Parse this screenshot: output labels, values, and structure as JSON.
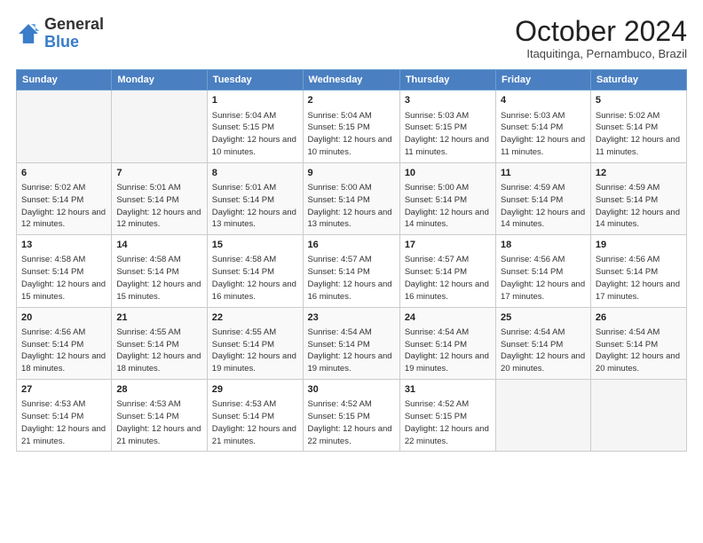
{
  "header": {
    "logo_general": "General",
    "logo_blue": "Blue",
    "month_title": "October 2024",
    "location": "Itaquitinga, Pernambuco, Brazil"
  },
  "days_of_week": [
    "Sunday",
    "Monday",
    "Tuesday",
    "Wednesday",
    "Thursday",
    "Friday",
    "Saturday"
  ],
  "weeks": [
    [
      {
        "day": "",
        "info": ""
      },
      {
        "day": "",
        "info": ""
      },
      {
        "day": "1",
        "info": "Sunrise: 5:04 AM\nSunset: 5:15 PM\nDaylight: 12 hours and 10 minutes."
      },
      {
        "day": "2",
        "info": "Sunrise: 5:04 AM\nSunset: 5:15 PM\nDaylight: 12 hours and 10 minutes."
      },
      {
        "day": "3",
        "info": "Sunrise: 5:03 AM\nSunset: 5:15 PM\nDaylight: 12 hours and 11 minutes."
      },
      {
        "day": "4",
        "info": "Sunrise: 5:03 AM\nSunset: 5:14 PM\nDaylight: 12 hours and 11 minutes."
      },
      {
        "day": "5",
        "info": "Sunrise: 5:02 AM\nSunset: 5:14 PM\nDaylight: 12 hours and 11 minutes."
      }
    ],
    [
      {
        "day": "6",
        "info": "Sunrise: 5:02 AM\nSunset: 5:14 PM\nDaylight: 12 hours and 12 minutes."
      },
      {
        "day": "7",
        "info": "Sunrise: 5:01 AM\nSunset: 5:14 PM\nDaylight: 12 hours and 12 minutes."
      },
      {
        "day": "8",
        "info": "Sunrise: 5:01 AM\nSunset: 5:14 PM\nDaylight: 12 hours and 13 minutes."
      },
      {
        "day": "9",
        "info": "Sunrise: 5:00 AM\nSunset: 5:14 PM\nDaylight: 12 hours and 13 minutes."
      },
      {
        "day": "10",
        "info": "Sunrise: 5:00 AM\nSunset: 5:14 PM\nDaylight: 12 hours and 14 minutes."
      },
      {
        "day": "11",
        "info": "Sunrise: 4:59 AM\nSunset: 5:14 PM\nDaylight: 12 hours and 14 minutes."
      },
      {
        "day": "12",
        "info": "Sunrise: 4:59 AM\nSunset: 5:14 PM\nDaylight: 12 hours and 14 minutes."
      }
    ],
    [
      {
        "day": "13",
        "info": "Sunrise: 4:58 AM\nSunset: 5:14 PM\nDaylight: 12 hours and 15 minutes."
      },
      {
        "day": "14",
        "info": "Sunrise: 4:58 AM\nSunset: 5:14 PM\nDaylight: 12 hours and 15 minutes."
      },
      {
        "day": "15",
        "info": "Sunrise: 4:58 AM\nSunset: 5:14 PM\nDaylight: 12 hours and 16 minutes."
      },
      {
        "day": "16",
        "info": "Sunrise: 4:57 AM\nSunset: 5:14 PM\nDaylight: 12 hours and 16 minutes."
      },
      {
        "day": "17",
        "info": "Sunrise: 4:57 AM\nSunset: 5:14 PM\nDaylight: 12 hours and 16 minutes."
      },
      {
        "day": "18",
        "info": "Sunrise: 4:56 AM\nSunset: 5:14 PM\nDaylight: 12 hours and 17 minutes."
      },
      {
        "day": "19",
        "info": "Sunrise: 4:56 AM\nSunset: 5:14 PM\nDaylight: 12 hours and 17 minutes."
      }
    ],
    [
      {
        "day": "20",
        "info": "Sunrise: 4:56 AM\nSunset: 5:14 PM\nDaylight: 12 hours and 18 minutes."
      },
      {
        "day": "21",
        "info": "Sunrise: 4:55 AM\nSunset: 5:14 PM\nDaylight: 12 hours and 18 minutes."
      },
      {
        "day": "22",
        "info": "Sunrise: 4:55 AM\nSunset: 5:14 PM\nDaylight: 12 hours and 19 minutes."
      },
      {
        "day": "23",
        "info": "Sunrise: 4:54 AM\nSunset: 5:14 PM\nDaylight: 12 hours and 19 minutes."
      },
      {
        "day": "24",
        "info": "Sunrise: 4:54 AM\nSunset: 5:14 PM\nDaylight: 12 hours and 19 minutes."
      },
      {
        "day": "25",
        "info": "Sunrise: 4:54 AM\nSunset: 5:14 PM\nDaylight: 12 hours and 20 minutes."
      },
      {
        "day": "26",
        "info": "Sunrise: 4:54 AM\nSunset: 5:14 PM\nDaylight: 12 hours and 20 minutes."
      }
    ],
    [
      {
        "day": "27",
        "info": "Sunrise: 4:53 AM\nSunset: 5:14 PM\nDaylight: 12 hours and 21 minutes."
      },
      {
        "day": "28",
        "info": "Sunrise: 4:53 AM\nSunset: 5:14 PM\nDaylight: 12 hours and 21 minutes."
      },
      {
        "day": "29",
        "info": "Sunrise: 4:53 AM\nSunset: 5:14 PM\nDaylight: 12 hours and 21 minutes."
      },
      {
        "day": "30",
        "info": "Sunrise: 4:52 AM\nSunset: 5:15 PM\nDaylight: 12 hours and 22 minutes."
      },
      {
        "day": "31",
        "info": "Sunrise: 4:52 AM\nSunset: 5:15 PM\nDaylight: 12 hours and 22 minutes."
      },
      {
        "day": "",
        "info": ""
      },
      {
        "day": "",
        "info": ""
      }
    ]
  ]
}
